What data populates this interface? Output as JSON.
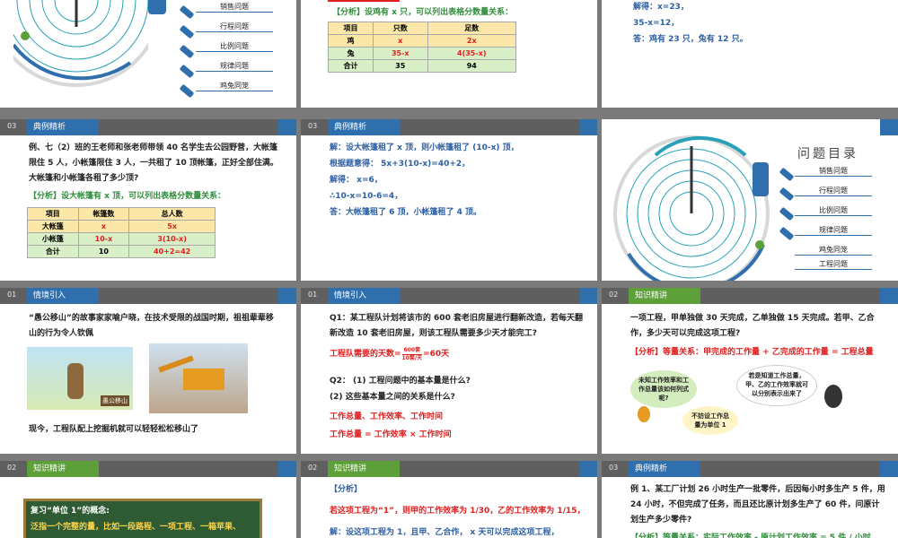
{
  "colors": {
    "blue": "#2d5fa3",
    "red": "#e02020",
    "green": "#5d9f39",
    "header": "#5f5f5f"
  },
  "menu": {
    "title": "问题目录",
    "items": [
      "销售问题",
      "行程问题",
      "比例问题",
      "规律问题",
      "鸡兔同笼",
      "工程问题"
    ]
  },
  "s1": {
    "items": [
      "销售问题",
      "行程问题",
      "比例问题",
      "规律问题",
      "鸡兔同笼"
    ]
  },
  "s2": {
    "analysis": "【分析】设鸡有 x 只，可以列出表格分数量关系：",
    "headers": [
      "项目",
      "只数",
      "足数"
    ],
    "rows": [
      [
        "鸡",
        "x",
        "2x"
      ],
      [
        "兔",
        "35-x",
        "4(35-x)"
      ],
      [
        "合计",
        "35",
        "94"
      ]
    ]
  },
  "s3": {
    "lines": [
      "解得：x=23，",
      "35-x=12，",
      "答：鸡有 23 只，兔有 12 只。"
    ]
  },
  "s4": {
    "num": "03",
    "title": "典例精析",
    "problem": "例、七（2）班的王老师和张老师带领 40 名学生去公园野营，大帐篷限住 5 人，小帐篷限住 3 人，一共租了 10 顶帐篷，正好全部住满。大帐篷和小帐篷各租了多少顶?",
    "analysis": "【分析】设大帐篷有 x 顶，可以列出表格分数量关系：",
    "headers": [
      "项目",
      "帐篷数",
      "总人数"
    ],
    "rows": [
      [
        "大帐篷",
        "x",
        "5x"
      ],
      [
        "小帐篷",
        "10-x",
        "3(10-x)"
      ],
      [
        "合计",
        "10",
        "40+2=42"
      ]
    ]
  },
  "s5": {
    "num": "03",
    "title": "典例精析",
    "lines": [
      "解：设大帐篷租了 x 顶，则小帐篷租了 (10-x) 顶，",
      "根据题意得：  5x+3(10-x)=40+2，",
      "解得：  x=6，",
      "∴10-x=10-6=4，",
      "答：大帐篷租了 6 顶，小帐篷租了 4 顶。"
    ]
  },
  "s7": {
    "num": "01",
    "title": "情境引入",
    "intro": "“愚公移山”的故事家家喻户晓，在技术受限的战国时期，祖祖辈辈移山的行为令人钦佩",
    "caption": "愚公移山",
    "footer": "现今，工程队配上挖掘机就可以轻轻松松移山了"
  },
  "s8": {
    "num": "01",
    "title": "情境引入",
    "q1": "Q1：某工程队计划将该市的 600 套老旧房屋进行翻新改造，若每天翻新改造 10 套老旧房屋，则该工程队需要多少天才能完工?",
    "days_label": "工程队需要的天数=",
    "frac_num": "600套",
    "frac_den": "10套/天",
    "days_result": "=60天",
    "q2a": "Q2：  (1) 工程问题中的基本量是什么?",
    "q2b": "(2) 这些基本量之间的关系是什么?",
    "a1": "工作总量、工作效率、工作时间",
    "a2": "工作总量 = 工作效率 × 工作时间"
  },
  "s9": {
    "num": "02",
    "title": "知识精讲",
    "problem": "一项工程，甲单独做 30 天完成，乙单独做 15 天完成。若甲、乙合作，多少天可以完成这项工程?",
    "analysis": "【分析】等量关系：甲完成的工作量 + 乙完成的工作量 = 工程总量",
    "b1": "未知工作效率和工作总量该如何列式呢?",
    "b2": "若是知道工作总量，甲、乙的工作效率就可以分别表示出来了",
    "b3": "不妨设工作总量为单位 1"
  },
  "s10": {
    "num": "02",
    "title": "知识精讲",
    "l1": "复习“单位 1”的概念:",
    "l2": "泛指一个完整的量，比如一段路程、一项工程、一箱苹果、"
  },
  "s11": {
    "num": "02",
    "title": "知识精讲",
    "analysis": "【分析】",
    "l1": "若这项工程为“1”，则甲的工作效率为 1/30，乙的工作效率为 1/15，",
    "l2": "解：设这项工程为 1，且甲、乙合作， x 天可以完成这项工程，"
  },
  "s12": {
    "num": "03",
    "title": "典例精析",
    "problem": "例 1、某工厂计划 26 小时生产一批零件，后因每小时多生产 5 件，用 24 小时，不但完成了任务，而且还比原计划多生产了 60 件，问原计划生产多少零件?",
    "analysis": "【分析】等量关系：实际工作效率 - 原计划工作效率 = 5 件 / 小时"
  }
}
